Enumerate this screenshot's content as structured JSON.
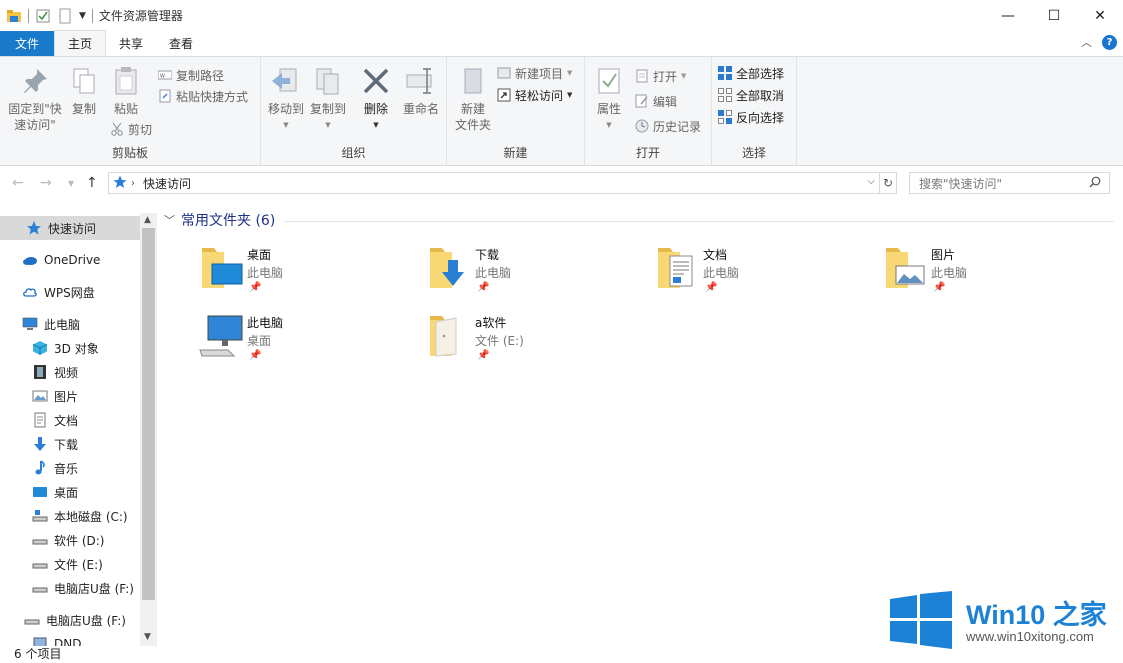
{
  "window": {
    "title": "文件资源管理器",
    "minimize_glyph": "—",
    "maximize_glyph": "☐",
    "close_glyph": "✕"
  },
  "tabs": [
    {
      "label": "文件"
    },
    {
      "label": "主页"
    },
    {
      "label": "共享"
    },
    {
      "label": "查看"
    }
  ],
  "ribbon": {
    "clipboard": {
      "label": "剪贴板",
      "pin_label_1": "固定到\"快",
      "pin_label_2": "速访问\"",
      "copy": "复制",
      "paste": "粘贴",
      "copy_path": "复制路径",
      "paste_shortcut": "粘贴快捷方式",
      "cut": "剪切"
    },
    "organize": {
      "label": "组织",
      "move_to": "移动到",
      "copy_to": "复制到",
      "delete": "删除",
      "rename": "重命名"
    },
    "new": {
      "label": "新建",
      "new_folder_1": "新建",
      "new_folder_2": "文件夹",
      "new_item": "新建项目",
      "easy_access": "轻松访问"
    },
    "open": {
      "label": "打开",
      "properties": "属性",
      "open": "打开",
      "edit": "编辑",
      "history": "历史记录"
    },
    "select": {
      "label": "选择",
      "select_all": "全部选择",
      "select_none": "全部取消",
      "invert": "反向选择"
    }
  },
  "address": {
    "path": "快速访问",
    "search_placeholder": "搜索\"快速访问\""
  },
  "nav": {
    "items": [
      {
        "label": "快速访问",
        "icon": "star-icon"
      },
      {
        "label": "OneDrive",
        "icon": "cloud-icon"
      },
      {
        "label": "WPS网盘",
        "icon": "cloud-icon"
      },
      {
        "label": "此电脑",
        "icon": "computer-icon"
      },
      {
        "label": "3D 对象",
        "icon": "cube-icon"
      },
      {
        "label": "视频",
        "icon": "video-icon"
      },
      {
        "label": "图片",
        "icon": "picture-icon"
      },
      {
        "label": "文档",
        "icon": "document-icon"
      },
      {
        "label": "下载",
        "icon": "download-icon"
      },
      {
        "label": "音乐",
        "icon": "music-icon"
      },
      {
        "label": "桌面",
        "icon": "desktop-icon"
      },
      {
        "label": "本地磁盘 (C:)",
        "icon": "drive-icon"
      },
      {
        "label": "软件 (D:)",
        "icon": "drive-icon"
      },
      {
        "label": "文件 (E:)",
        "icon": "drive-icon"
      },
      {
        "label": "电脑店U盘 (F:)",
        "icon": "usb-drive-icon"
      },
      {
        "label": "电脑店U盘 (F:)",
        "icon": "usb-drive-icon"
      },
      {
        "label": "DND",
        "icon": "network-icon"
      }
    ]
  },
  "main": {
    "group_title": "常用文件夹 (6)",
    "folders": [
      {
        "name": "桌面",
        "sub": "此电脑",
        "icon": "desktop-folder-icon"
      },
      {
        "name": "下载",
        "sub": "此电脑",
        "icon": "downloads-folder-icon"
      },
      {
        "name": "文档",
        "sub": "此电脑",
        "icon": "documents-folder-icon"
      },
      {
        "name": "图片",
        "sub": "此电脑",
        "icon": "pictures-folder-icon"
      },
      {
        "name": "此电脑",
        "sub": "桌面",
        "icon": "computer-icon"
      },
      {
        "name": "a软件",
        "sub": "文件 (E:)",
        "icon": "folder-icon"
      }
    ]
  },
  "status": {
    "count": "6 个项目"
  },
  "watermark": {
    "title": "Win10 之家",
    "url": "www.win10xitong.com"
  },
  "colors": {
    "accent": "#1979ca",
    "folder_yellow": "#f8d775",
    "watermark_blue": "#1c82d6"
  }
}
